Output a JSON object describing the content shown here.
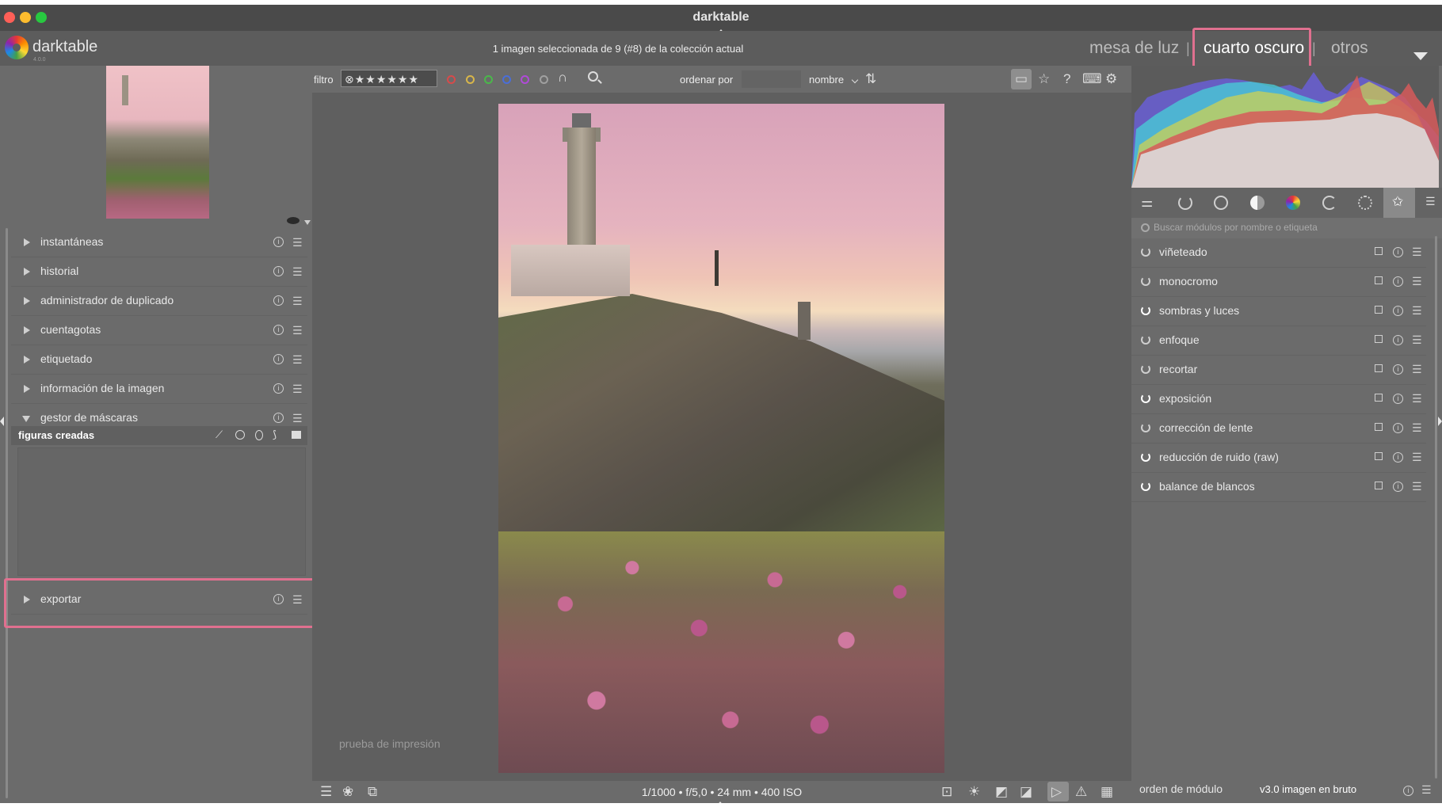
{
  "window": {
    "title": "darktable"
  },
  "header": {
    "app_name": "darktable",
    "app_version": "4.0.0",
    "info": "1 imagen seleccionada de 9 (#8) de la colección actual",
    "views": {
      "lighttable": "mesa de luz",
      "darkroom": "cuarto oscuro",
      "other": "otros"
    },
    "separator": "|"
  },
  "left_modules": [
    {
      "label": "instantáneas"
    },
    {
      "label": "historial"
    },
    {
      "label": "administrador de duplicado"
    },
    {
      "label": "cuentagotas"
    },
    {
      "label": "etiquetado"
    },
    {
      "label": "información de la imagen"
    },
    {
      "label": "gestor de máscaras"
    }
  ],
  "mask_manager": {
    "created_shapes_label": "figuras creadas"
  },
  "export_module": {
    "label": "exportar"
  },
  "filterbar": {
    "filter_label": "filtro",
    "stars": "⊗★★★★★★",
    "sort_label": "ordenar por",
    "sort_value": "nombre",
    "color_labels": [
      "#d84a4a",
      "#d8b64a",
      "#4ab84a",
      "#4a6ed8",
      "#b04ad8",
      "#a0a0a0"
    ]
  },
  "center": {
    "softproof_text": "prueba de impresión",
    "exif": "1/1000 • f/5,0 • 24 mm • 400 ISO"
  },
  "right_panel": {
    "search_placeholder": "Buscar módulos por nombre o etiqueta",
    "modules": [
      {
        "label": "viñeteado",
        "on": false
      },
      {
        "label": "monocromo",
        "on": false
      },
      {
        "label": "sombras y luces",
        "on": true
      },
      {
        "label": "enfoque",
        "on": false
      },
      {
        "label": "recortar",
        "on": false
      },
      {
        "label": "exposición",
        "on": true
      },
      {
        "label": "corrección de lente",
        "on": false
      },
      {
        "label": "reducción de ruido (raw)",
        "on": true
      },
      {
        "label": "balance de blancos",
        "on": true
      }
    ],
    "module_order_label": "orden de módulo",
    "module_order_value": "v3.0 imagen en bruto"
  },
  "highlight_color": "#e0708f"
}
